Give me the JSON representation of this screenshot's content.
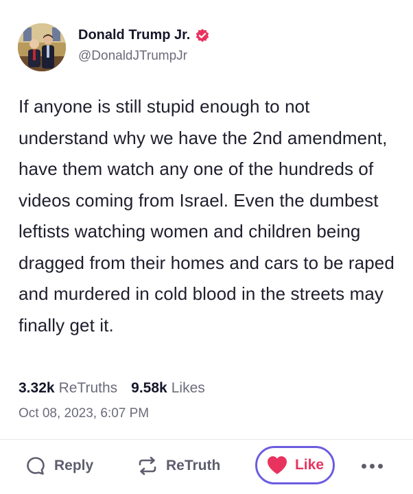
{
  "author": {
    "display_name": "Donald Trump Jr.",
    "handle": "@DonaldJTrumpJr",
    "verified_color": "#e9335f"
  },
  "post": {
    "text": "If anyone is still stupid enough to not understand why we have the 2nd amendment, have them watch any one of the hundreds of videos coming from Israel. Even the dumbest leftists watching women and children being dragged from their homes and cars to be raped and murdered in cold blood in the streets may finally get it.",
    "timestamp": "Oct 08, 2023, 6:07 PM"
  },
  "stats": {
    "retruths_count": "3.32k",
    "retruths_label": "ReTruths",
    "likes_count": "9.58k",
    "likes_label": "Likes"
  },
  "actions": {
    "reply_label": "Reply",
    "retruth_label": "ReTruth",
    "like_label": "Like",
    "like_color": "#e9335f",
    "like_ring_color": "#6b5ce0"
  },
  "icons": {
    "reply": "speech-bubble-icon",
    "retruth": "repost-arrows-icon",
    "like": "heart-icon",
    "more": "ellipsis-icon",
    "verified": "verified-badge-icon"
  }
}
